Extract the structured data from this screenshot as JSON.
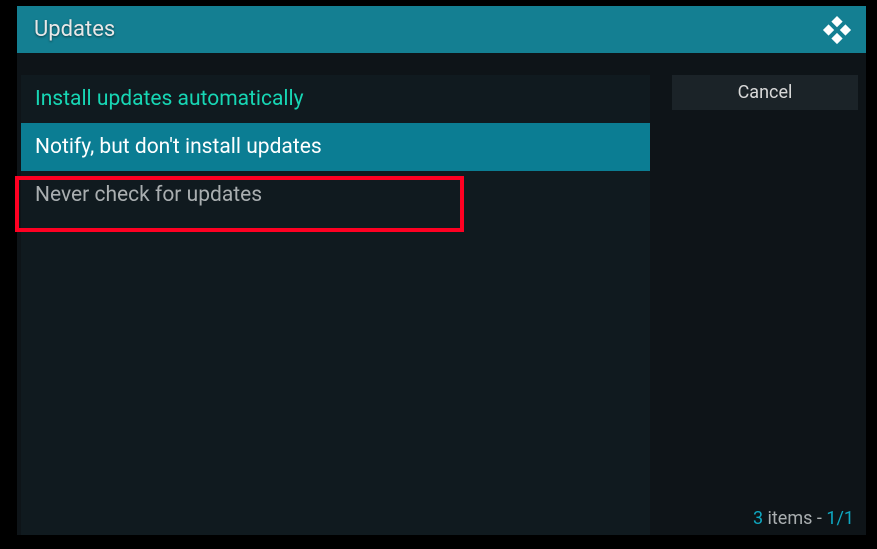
{
  "title": "Updates",
  "options": [
    "Install updates automatically",
    "Notify, but don't install updates",
    "Never check for updates"
  ],
  "cancel": "Cancel",
  "footer": {
    "count": "3",
    "itemsLabel": " items - ",
    "page": "1/1"
  }
}
